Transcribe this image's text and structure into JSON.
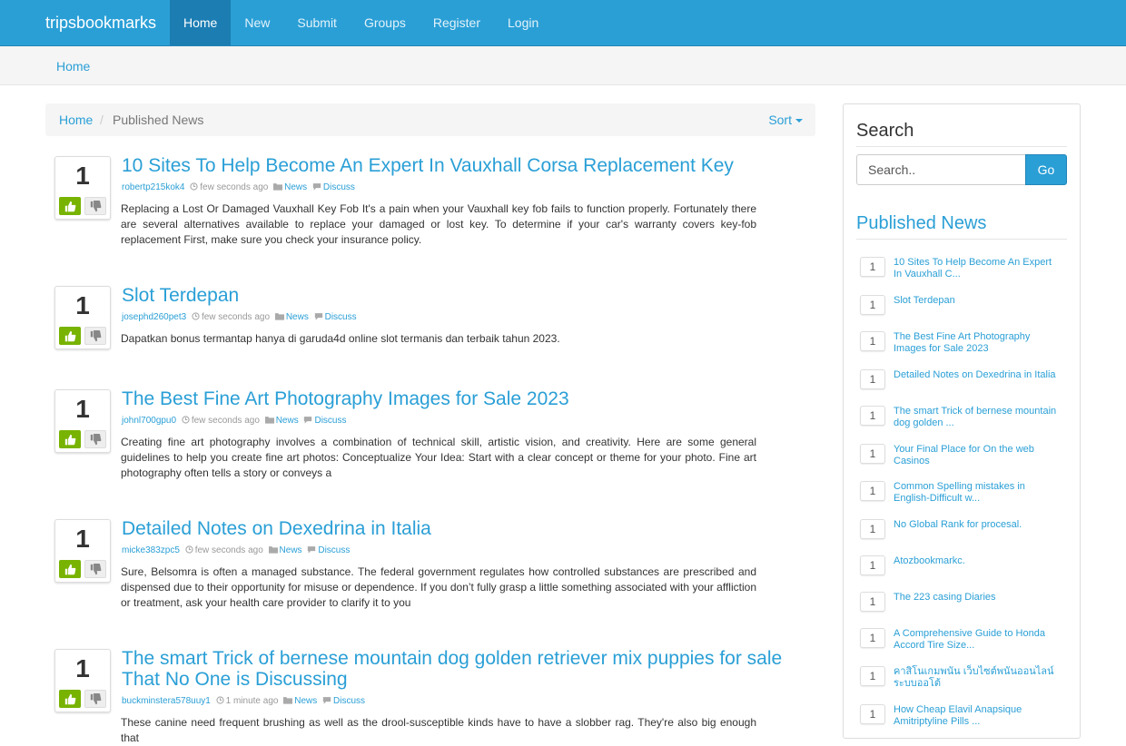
{
  "brand": "tripsbookmarks",
  "nav": [
    "Home",
    "New",
    "Submit",
    "Groups",
    "Register",
    "Login"
  ],
  "subbar_crumb": "Home",
  "breadcrumb": {
    "home": "Home",
    "separator": "/",
    "current": "Published News",
    "sort": "Sort"
  },
  "posts": [
    {
      "votes": "1",
      "title": "10 Sites To Help Become An Expert In Vauxhall Corsa Replacement Key",
      "author": "robertp215kok4",
      "time": "few seconds ago",
      "category": "News",
      "discuss": "Discuss",
      "excerpt": "Replacing a Lost Or Damaged Vauxhall Key Fob It's a pain when your Vauxhall key fob fails to function properly. Fortunately there are several alternatives available to replace your damaged or lost key. To determine if your car's warranty covers key-fob replacement First, make sure you check your insurance policy."
    },
    {
      "votes": "1",
      "title": "Slot Terdepan",
      "author": "josephd260pet3",
      "time": "few seconds ago",
      "category": "News",
      "discuss": "Discuss",
      "excerpt": "Dapatkan bonus termantap hanya di garuda4d online slot termanis dan terbaik tahun 2023."
    },
    {
      "votes": "1",
      "title": "The Best Fine Art Photography Images for Sale 2023",
      "author": "johnl700gpu0",
      "time": "few seconds ago",
      "category": "News",
      "discuss": "Discuss",
      "excerpt": "Creating fine art photography involves a combination of technical skill, artistic vision, and creativity. Here are some general guidelines to help you create fine art photos: Conceptualize Your Idea: Start with a clear concept or theme for your photo. Fine art photography often tells a story or conveys a"
    },
    {
      "votes": "1",
      "title": "Detailed Notes on Dexedrina in Italia",
      "author": "micke383zpc5",
      "time": "few seconds ago",
      "category": "News",
      "discuss": "Discuss",
      "excerpt": "Sure, Belsomra is often a managed substance. The federal government regulates how controlled substances are prescribed and dispensed due to their opportunity for misuse or dependence. If you don’t fully grasp a little something associated with your affliction or treatment, ask your health care provider to clarify it to you"
    },
    {
      "votes": "1",
      "title": "The smart Trick of bernese mountain dog golden retriever mix puppies for sale That No One is Discussing",
      "author": "buckminstera578uuy1",
      "time": "1 minute ago",
      "category": "News",
      "discuss": "Discuss",
      "excerpt": "These canine need frequent brushing as well as the drool-susceptible kinds have to have a slobber rag. They're also big enough that"
    }
  ],
  "sidebar": {
    "search_title": "Search",
    "search_placeholder": "Search..",
    "go_label": "Go",
    "published_title": "Published News",
    "items": [
      {
        "count": "1",
        "label": "10 Sites To Help Become An Expert In Vauxhall C..."
      },
      {
        "count": "1",
        "label": "Slot Terdepan"
      },
      {
        "count": "1",
        "label": "The Best Fine Art Photography Images for Sale 2023"
      },
      {
        "count": "1",
        "label": "Detailed Notes on Dexedrina in Italia"
      },
      {
        "count": "1",
        "label": "The smart Trick of bernese mountain dog golden ..."
      },
      {
        "count": "1",
        "label": "Your Final Place for On the web Casinos"
      },
      {
        "count": "1",
        "label": "Common Spelling mistakes in English-Difficult w..."
      },
      {
        "count": "1",
        "label": "No Global Rank for procesal."
      },
      {
        "count": "1",
        "label": "Atozbookmarkc."
      },
      {
        "count": "1",
        "label": "The 223 casing Diaries"
      },
      {
        "count": "1",
        "label": "A Comprehensive Guide to Honda Accord Tire Size..."
      },
      {
        "count": "1",
        "label": "คาสิโนเกมพนัน เว็บไซต์พนันออนไลน์ ระบบออโต้"
      },
      {
        "count": "1",
        "label": "How Cheap Elavil Anapsique Amitriptyline Pills ..."
      }
    ]
  },
  "colors": {
    "accent": "#2a9fd6",
    "upvote": "#77b300"
  }
}
